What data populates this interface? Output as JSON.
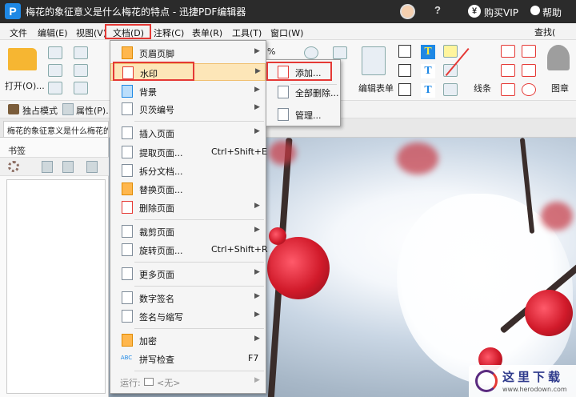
{
  "window": {
    "title": "梅花的象征意义是什么梅花的特点 - 迅捷PDF编辑器",
    "logo_letter": "P",
    "help_glyph": "?",
    "vip_symbol": "¥",
    "vip_label": "购买VIP",
    "help_label": "帮助"
  },
  "menubar": {
    "items": [
      "文件",
      "编辑(E)",
      "视图(V)",
      "文档(D)",
      "注释(C)",
      "表单(R)",
      "工具(T)",
      "窗口(W)"
    ],
    "find_label": "查找("
  },
  "toolbar": {
    "open_label": "打开(O)...",
    "zoom_value": "%",
    "edit_form_label": "编辑表单",
    "line_label": "线条",
    "stamp_label": "图章",
    "text_tool_glyph": "T"
  },
  "modebar": {
    "solo_mode_label": "独占模式",
    "properties_label": "属性(P)..."
  },
  "document_tab": {
    "title": "梅花的象征意义是什么梅花的"
  },
  "sidebar": {
    "bookmarks_label": "书签"
  },
  "doc_menu": {
    "items": [
      {
        "label": "页眉页脚",
        "shortcut": "",
        "arrow": "▶"
      },
      {
        "label": "水印",
        "shortcut": "",
        "arrow": "▶"
      },
      {
        "label": "背景",
        "shortcut": "",
        "arrow": "▶"
      },
      {
        "label": "贝茨编号",
        "shortcut": "",
        "arrow": "▶"
      },
      {
        "label": "插入页面",
        "shortcut": "",
        "arrow": "▶"
      },
      {
        "label": "提取页面...",
        "shortcut": "Ctrl+Shift+E",
        "arrow": ""
      },
      {
        "label": "拆分文档...",
        "shortcut": "",
        "arrow": ""
      },
      {
        "label": "替换页面...",
        "shortcut": "",
        "arrow": ""
      },
      {
        "label": "删除页面",
        "shortcut": "",
        "arrow": "▶"
      },
      {
        "label": "裁剪页面",
        "shortcut": "",
        "arrow": "▶"
      },
      {
        "label": "旋转页面...",
        "shortcut": "Ctrl+Shift+R",
        "arrow": ""
      },
      {
        "label": "更多页面",
        "shortcut": "",
        "arrow": "▶"
      },
      {
        "label": "数字签名",
        "shortcut": "",
        "arrow": "▶"
      },
      {
        "label": "签名与缩写",
        "shortcut": "",
        "arrow": "▶"
      },
      {
        "label": "加密",
        "shortcut": "",
        "arrow": "▶"
      },
      {
        "label": "拼写检查",
        "shortcut": "F7",
        "arrow": ""
      }
    ],
    "spell_icon_text": "ABC",
    "run_label": "运行:",
    "run_value": "<无>",
    "run_arrow": "▶"
  },
  "watermark_submenu": {
    "items": [
      "添加...",
      "全部删除...",
      "管理..."
    ]
  },
  "site_badge": {
    "name": "这里下载",
    "url": "www.herodown.com"
  }
}
